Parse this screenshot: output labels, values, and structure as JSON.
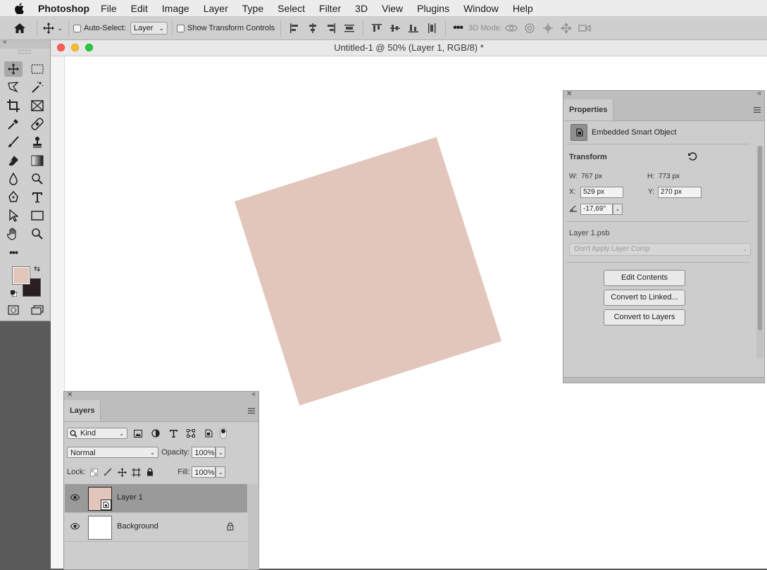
{
  "menubar": {
    "app": "Photoshop",
    "items": [
      "File",
      "Edit",
      "Image",
      "Layer",
      "Type",
      "Select",
      "Filter",
      "3D",
      "View",
      "Plugins",
      "Window",
      "Help"
    ]
  },
  "options_bar": {
    "auto_select_label": "Auto-Select:",
    "auto_select_value": "Layer",
    "show_transform_label": "Show Transform Controls",
    "mode_3d_label": "3D Mode:"
  },
  "document": {
    "title": "Untitled-1 @ 50% (Layer 1, RGB/8) *",
    "shape_color": "#e2c6bb"
  },
  "toolbar": {
    "foreground_color": "#e2c6bb",
    "background_color": "#2a1e1f"
  },
  "properties": {
    "tab": "Properties",
    "type_label": "Embedded Smart Object",
    "transform_title": "Transform",
    "w_label": "W:",
    "w_value": "767 px",
    "h_label": "H:",
    "h_value": "773 px",
    "x_label": "X:",
    "x_value": "529 px",
    "y_label": "Y:",
    "y_value": "270 px",
    "angle_value": "-17,69°",
    "file_name": "Layer 1.psb",
    "layer_comp": "Don't Apply Layer Comp",
    "buttons": {
      "edit": "Edit Contents",
      "linked": "Convert to Linked...",
      "layers": "Convert to Layers"
    }
  },
  "layers": {
    "tab": "Layers",
    "kind_label": "Kind",
    "blend_mode": "Normal",
    "opacity_label": "Opacity:",
    "opacity_value": "100%",
    "lock_label": "Lock:",
    "fill_label": "Fill:",
    "fill_value": "100%",
    "items": [
      {
        "name": "Layer 1",
        "selected": true
      },
      {
        "name": "Background",
        "locked": true
      }
    ]
  }
}
